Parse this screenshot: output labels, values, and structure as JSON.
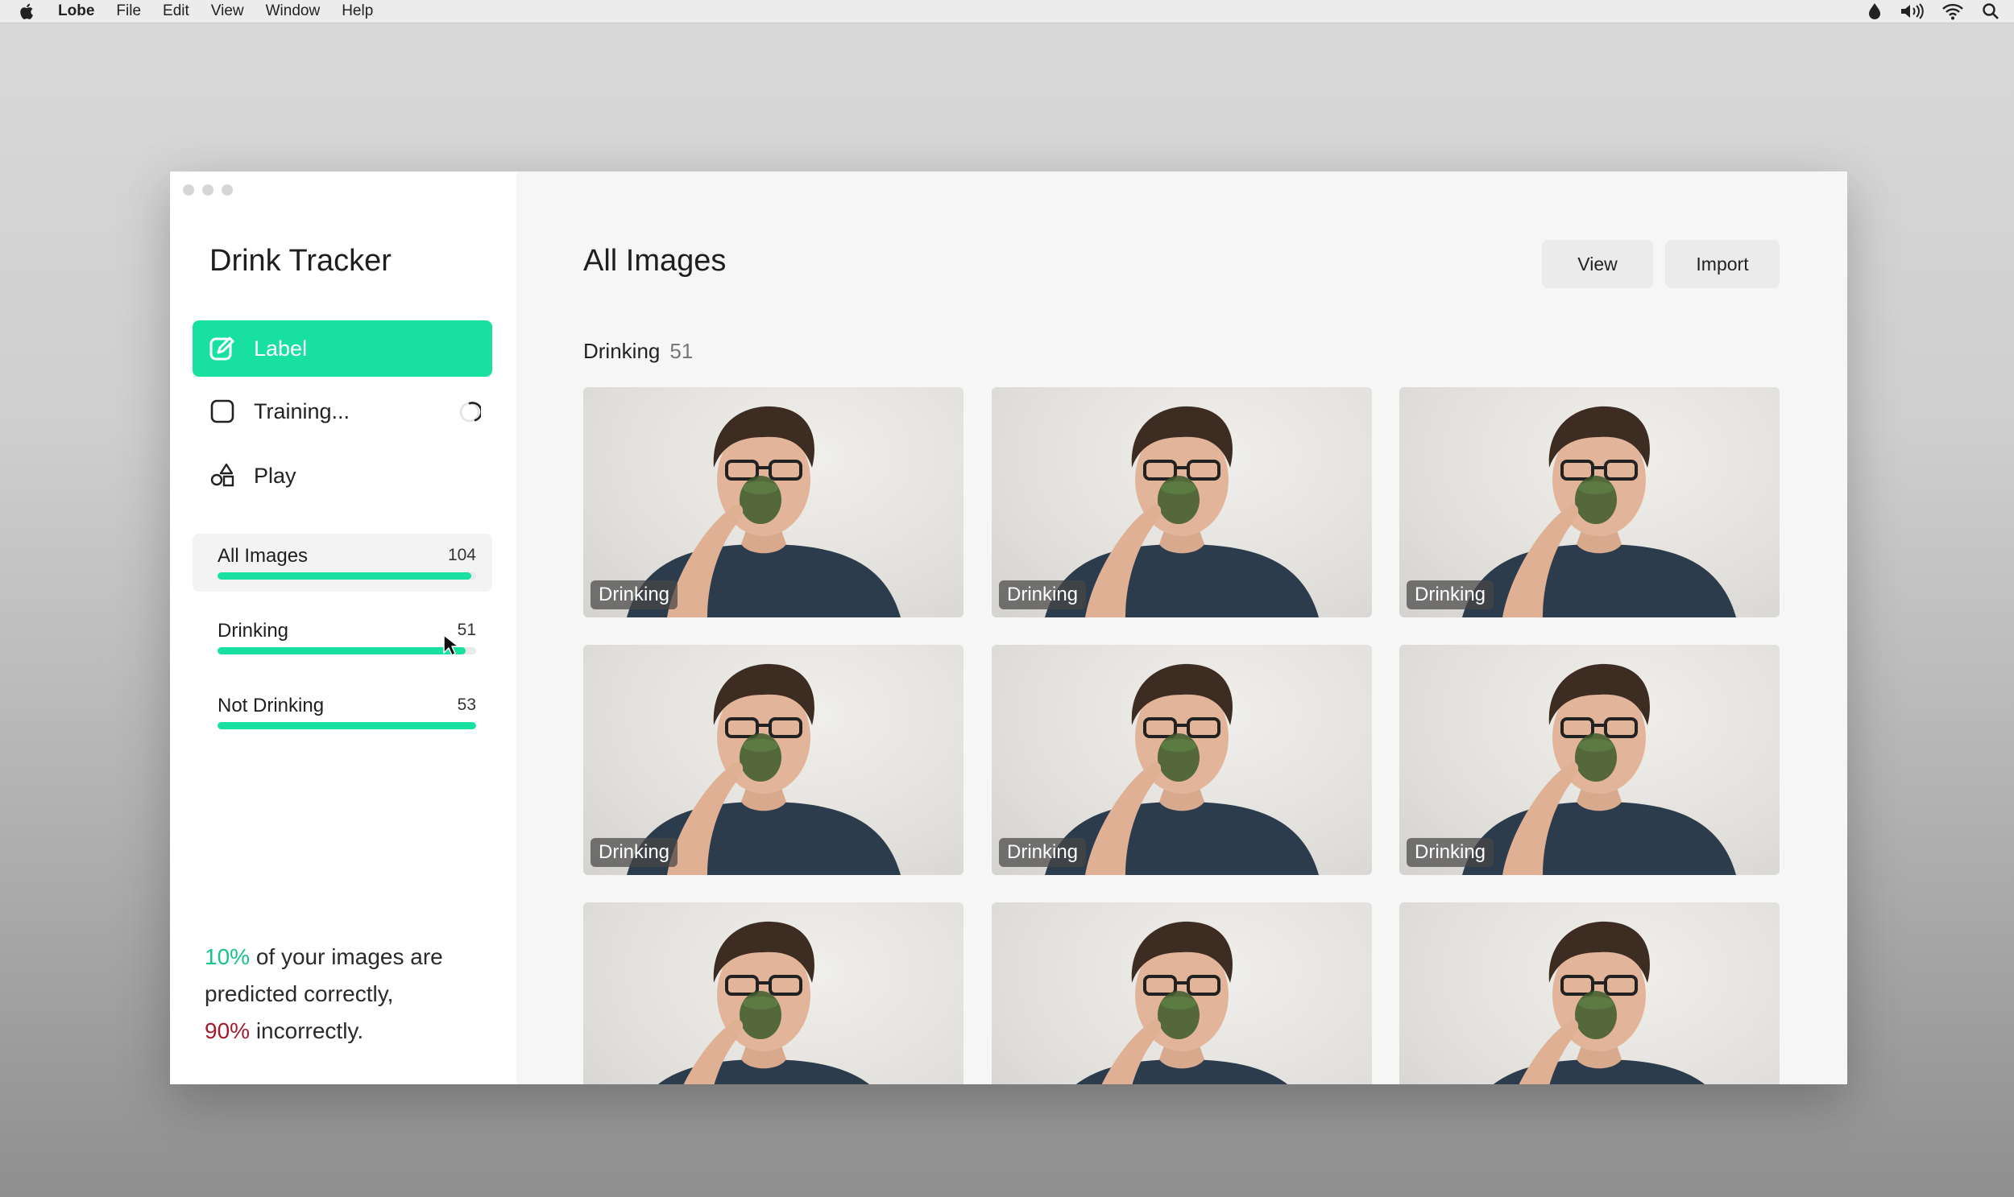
{
  "menubar": {
    "app_name": "Lobe",
    "items": [
      "File",
      "Edit",
      "View",
      "Window",
      "Help"
    ]
  },
  "sidebar": {
    "project_title": "Drink Tracker",
    "nav": [
      {
        "label": "Label",
        "icon": "edit-icon",
        "active": true
      },
      {
        "label": "Training...",
        "icon": "training-checkbox-icon",
        "active": false
      },
      {
        "label": "Play",
        "icon": "shapes-icon",
        "active": false
      }
    ],
    "categories": [
      {
        "name": "All Images",
        "count": "104",
        "fraction": 0.98
      },
      {
        "name": "Drinking",
        "count": "51",
        "fraction": 0.96
      },
      {
        "name": "Not Drinking",
        "count": "53",
        "fraction": 1.0
      }
    ],
    "stats": {
      "correct_pct": "10%",
      "correct_text": " of your images are predicted correctly,",
      "incorrect_pct": "90%",
      "incorrect_text": " incorrectly."
    }
  },
  "main": {
    "title": "All Images",
    "view_label": "View",
    "import_label": "Import",
    "section_label": "Drinking",
    "section_count": "51",
    "images": [
      {
        "label": "Drinking"
      },
      {
        "label": "Drinking"
      },
      {
        "label": "Drinking"
      },
      {
        "label": "Drinking"
      },
      {
        "label": "Drinking"
      },
      {
        "label": "Drinking"
      },
      {
        "label": ""
      },
      {
        "label": ""
      },
      {
        "label": ""
      }
    ]
  },
  "colors": {
    "accent": "#18e0a0",
    "correct": "#18c48c",
    "incorrect": "#a31c2b"
  }
}
